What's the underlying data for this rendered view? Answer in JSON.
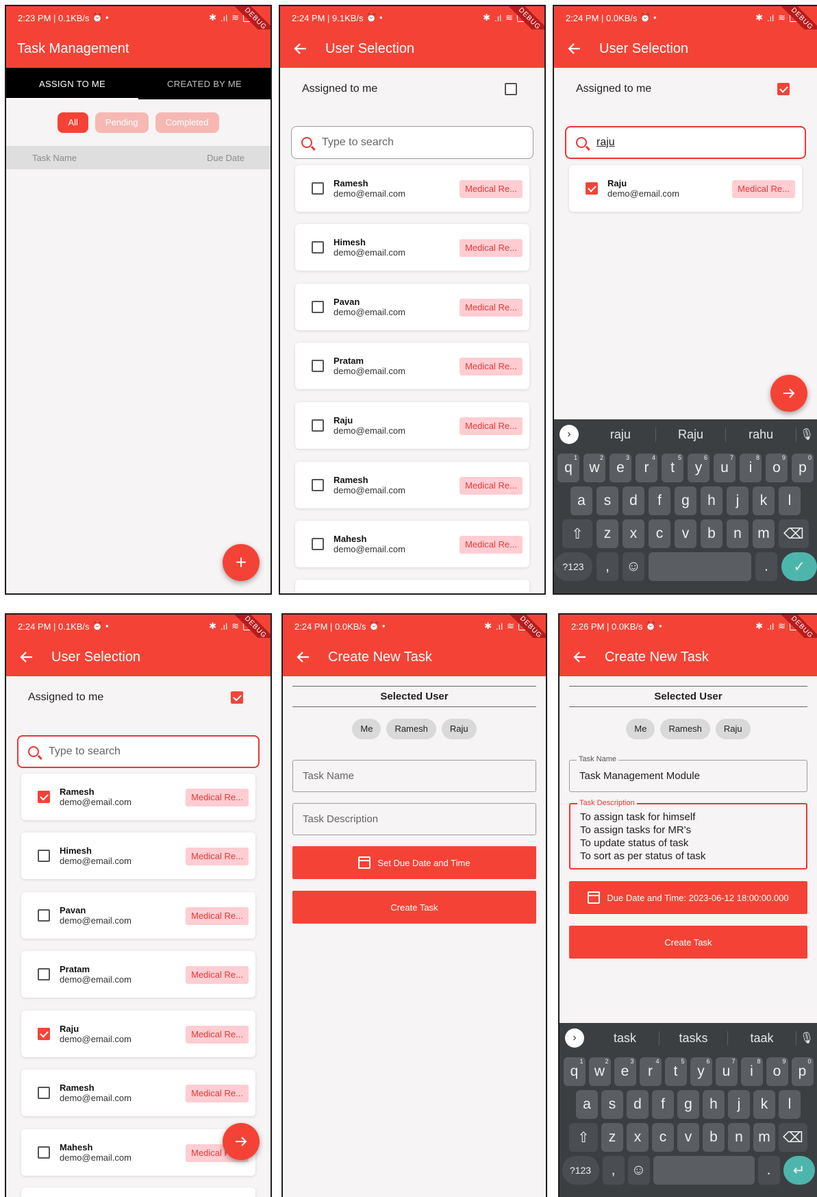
{
  "status": {
    "t1": "2:23 PM | 0.1KB/s",
    "t2": "2:24 PM | 9.1KB/s",
    "t3": "2:24 PM | 0.0KB/s",
    "t4": "2:24 PM | 0.1KB/s",
    "t5": "2:24 PM | 0.0KB/s",
    "t6": "2:26 PM | 0.0KB/s",
    "battery": "94",
    "debug": "DEBUG"
  },
  "screen1": {
    "title": "Task Management",
    "tab1": "ASSIGN TO ME",
    "tab2": "CREATED BY ME",
    "chip_all": "All",
    "chip_pending": "Pending",
    "chip_completed": "Completed",
    "col_name": "Task Name",
    "col_due": "Due Date",
    "fab": "+"
  },
  "user_select": {
    "title": "User Selection",
    "assigned": "Assigned to me",
    "placeholder": "Type to search",
    "query": "raju",
    "role": "Medical Re..."
  },
  "users": [
    {
      "name": "Ramesh",
      "email": "demo@email.com"
    },
    {
      "name": "Himesh",
      "email": "demo@email.com"
    },
    {
      "name": "Pavan",
      "email": "demo@email.com"
    },
    {
      "name": "Pratam",
      "email": "demo@email.com"
    },
    {
      "name": "Raju",
      "email": "demo@email.com"
    },
    {
      "name": "Ramesh",
      "email": "demo@email.com"
    },
    {
      "name": "Mahesh",
      "email": "demo@email.com"
    }
  ],
  "keyboard3": {
    "s1": "raju",
    "s2": "Raju",
    "s3": "rahu"
  },
  "keyboard6": {
    "s1": "task",
    "s2": "tasks",
    "s3": "taak"
  },
  "keys": {
    "row1": [
      "q",
      "w",
      "e",
      "r",
      "t",
      "y",
      "u",
      "i",
      "o",
      "p"
    ],
    "nums": [
      "1",
      "2",
      "3",
      "4",
      "5",
      "6",
      "7",
      "8",
      "9",
      "0"
    ],
    "row2": [
      "a",
      "s",
      "d",
      "f",
      "g",
      "h",
      "j",
      "k",
      "l"
    ],
    "row3": [
      "z",
      "x",
      "c",
      "v",
      "b",
      "n",
      "m"
    ],
    "sym": "?123",
    "comma": ",",
    "dot": "."
  },
  "create": {
    "title": "Create New Task",
    "selected_user": "Selected User",
    "pill_me": "Me",
    "pill_ramesh": "Ramesh",
    "pill_raju": "Raju",
    "task_name_ph": "Task Name",
    "task_desc_ph": "Task Description",
    "due_btn": "Set Due Date and Time",
    "create_btn": "Create Task",
    "task_name_label": "Task Name",
    "task_name_value": "Task Management Module",
    "task_desc_label": "Task Description",
    "desc_lines": [
      "To assign task for himself",
      "To assign tasks for MR's",
      "To update status of task",
      "To sort as per status of task"
    ],
    "due_value": "Due Date and Time: 2023-06-12 18:00:00.000"
  }
}
